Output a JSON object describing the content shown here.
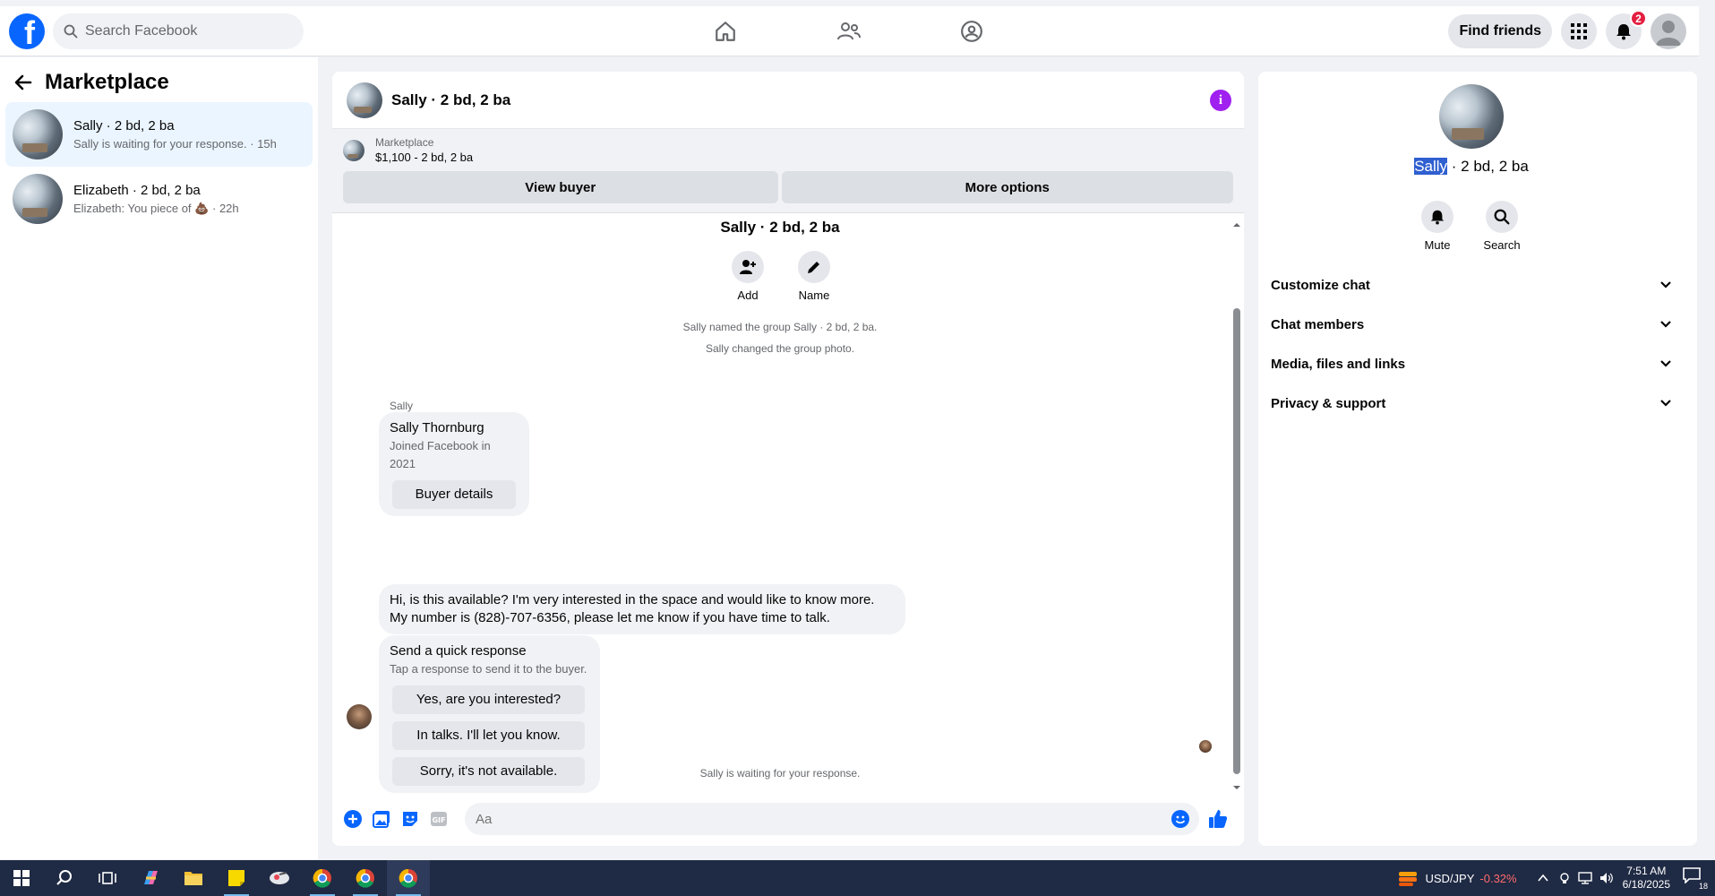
{
  "topbar": {
    "search_placeholder": "Search Facebook",
    "find_friends_label": "Find friends",
    "notification_count": "2"
  },
  "left_panel": {
    "title": "Marketplace",
    "conversations": [
      {
        "name": "Sally · 2 bd, 2 ba",
        "preview": "Sally is waiting for your response. · 15h",
        "active": true
      },
      {
        "name": "Elizabeth · 2 bd, 2 ba",
        "preview": "Elizabeth: You piece of",
        "emoji": "💩",
        "time": "· 22h",
        "active": false
      }
    ]
  },
  "chat": {
    "header_title": "Sally · 2 bd, 2 ba",
    "marketplace_label": "Marketplace",
    "listing": "$1,100 - 2 bd, 2 ba",
    "view_buyer_label": "View buyer",
    "more_options_label": "More options",
    "group_title": "Sally · 2 bd, 2 ba",
    "add_label": "Add",
    "name_label": "Name",
    "system_messages": [
      "Sally named the group Sally · 2 bd, 2 ba.",
      "Sally changed the group photo."
    ],
    "sender_name": "Sally",
    "profile_card": {
      "name": "Sally Thornburg",
      "joined": "Joined Facebook in 2021",
      "button": "Buyer details"
    },
    "message": "Hi, is this available? I'm very interested in the space and would like to know more. My number is (828)-707-6356, please let me know if you have time to talk.",
    "quick_response": {
      "title": "Send a quick response",
      "subtitle": "Tap a response to send it to the buyer.",
      "options": [
        "Yes, are you interested?",
        "In talks. I'll let you know.",
        "Sorry, it's not available."
      ]
    },
    "waiting_text": "Sally is waiting for your response.",
    "composer_placeholder": "Aa"
  },
  "right_panel": {
    "title_highlight": "Sally",
    "title_rest": " · 2 bd, 2 ba",
    "mute_label": "Mute",
    "search_label": "Search",
    "menu": [
      "Customize chat",
      "Chat members",
      "Media, files and links",
      "Privacy & support"
    ]
  },
  "taskbar": {
    "ticker_symbol": "USD/JPY",
    "ticker_change": "-0.32%",
    "time": "7:51 AM",
    "date": "6/18/2025",
    "notification_count": "18"
  },
  "colors": {
    "facebook_blue": "#0866ff",
    "messenger_purple": "#a020f0",
    "notification_red": "#e41e3f",
    "taskbar_bg": "#1f2a44",
    "ticker_negative": "#ff6b6b"
  }
}
